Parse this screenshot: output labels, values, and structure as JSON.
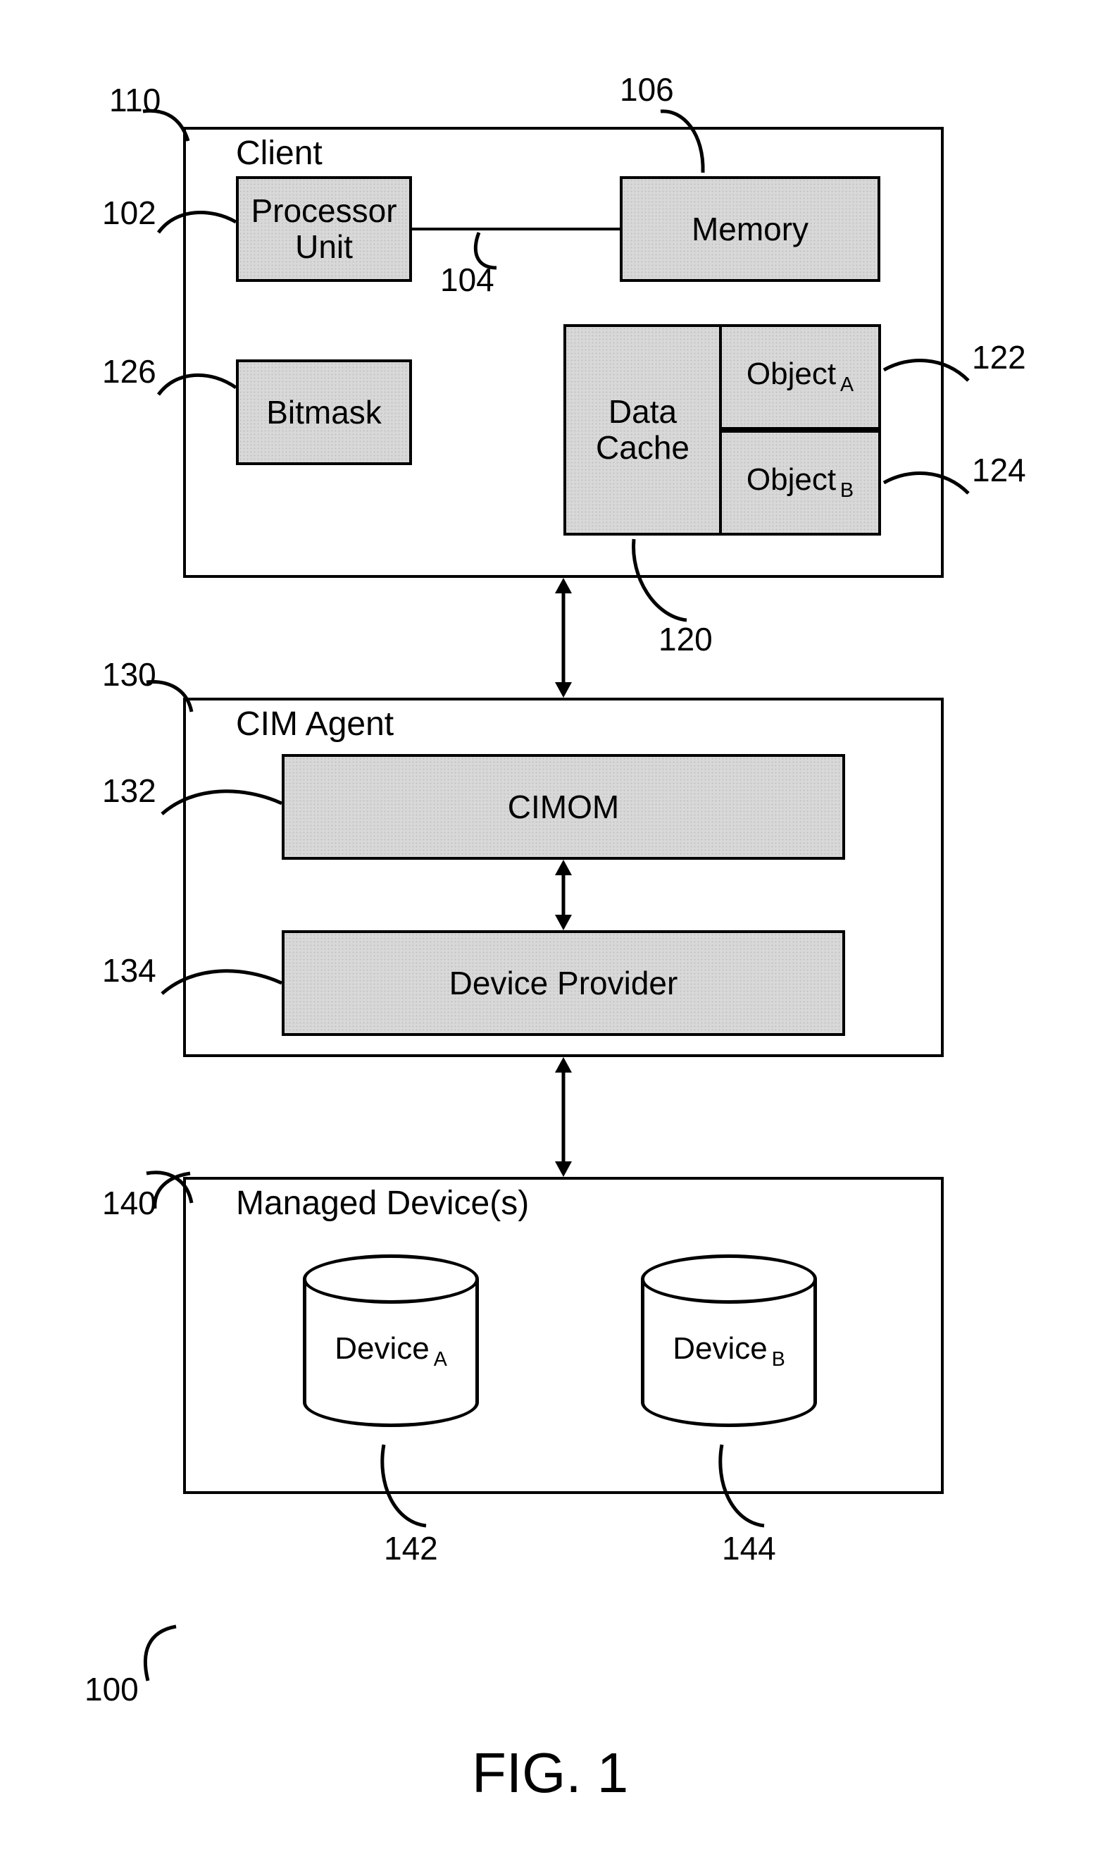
{
  "figure_label": "FIG. 1",
  "refs": {
    "r100": "100",
    "r102": "102",
    "r104": "104",
    "r106": "106",
    "r110": "110",
    "r120": "120",
    "r122": "122",
    "r124": "124",
    "r126": "126",
    "r130": "130",
    "r132": "132",
    "r134": "134",
    "r140": "140",
    "r142": "142",
    "r144": "144"
  },
  "client": {
    "title": "Client",
    "processor": "Processor Unit",
    "memory": "Memory",
    "bitmask": "Bitmask",
    "cache": "Data Cache",
    "objA_prefix": "Object",
    "objA_sub": "A",
    "objB_prefix": "Object",
    "objB_sub": "B"
  },
  "agent": {
    "title": "CIM Agent",
    "cimom": "CIMOM",
    "provider": "Device Provider"
  },
  "managed": {
    "title": "Managed Device(s)",
    "devA_prefix": "Device",
    "devA_sub": "A",
    "devB_prefix": "Device",
    "devB_sub": "B"
  }
}
